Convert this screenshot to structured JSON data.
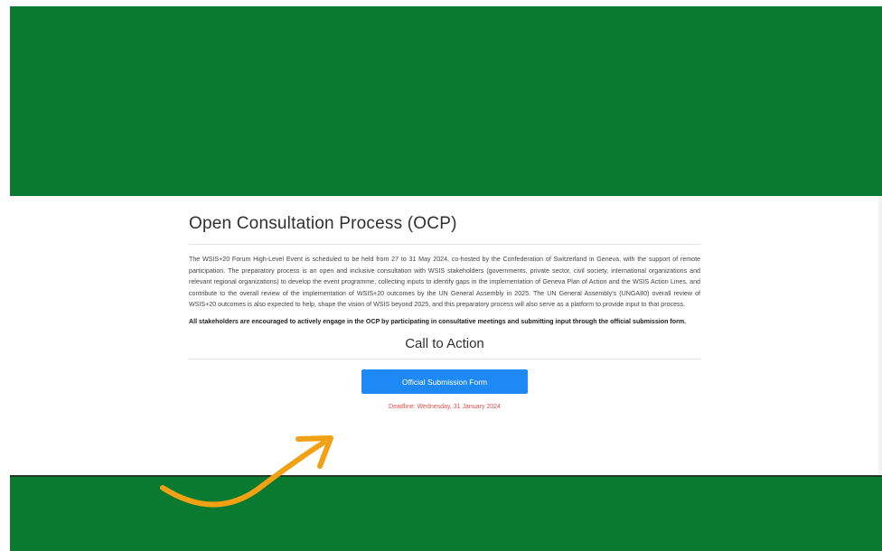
{
  "colors": {
    "banner": "#0a7a30",
    "button": "#1e88f5",
    "deadline": "#e0504a",
    "arrow": "#f2a114"
  },
  "page": {
    "title": "Open Consultation Process (OCP)",
    "paragraph": "The WSIS+20 Forum High-Level Event is scheduled to be held from 27 to 31 May 2024, co-hosted by the Confederation of Switzerland in Geneva, with the support of remote participation. The preparatory process is an open and inclusive consultation with WSIS stakeholders (governments, private sector, civil society, international organizations and relevant regional organizations) to develop the event programme, collecting inputs to identify gaps in the implementation of Geneva Plan of Action and the WSIS Action Lines, and contribute to the overall review of the implementation of WSIS+20 outcomes by the UN General Assembly in 2025. The UN General Assembly's (UNGA80) overall review of WSIS+20 outcomes is also expected to help, shape the vision of WSIS beyond 2025, and this preparatory process will also serve as a platform to provide input to that process.",
    "bold_paragraph": "All stakeholders are encouraged to actively engage in the OCP by participating in consultative meetings and submitting input through the official submission form.",
    "cta_title": "Call to Action",
    "button_label": "Official Submission Form",
    "deadline": "Deadline: Wednesday, 31 January 2024"
  },
  "overlay": {
    "arrow_icon": "curved-arrow-icon"
  }
}
